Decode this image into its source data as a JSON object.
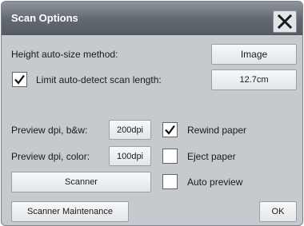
{
  "dialog": {
    "title": "Scan Options"
  },
  "height_method": {
    "label": "Height auto-size method:",
    "value": "Image"
  },
  "limit_scan": {
    "label": "Limit auto-detect scan length:",
    "checked": true,
    "value": "12.7cm"
  },
  "preview_bw": {
    "label": "Preview dpi, b&w:",
    "value": "200dpi"
  },
  "preview_color": {
    "label": "Preview dpi, color:",
    "value": "100dpi"
  },
  "scanner_button": "Scanner",
  "options": {
    "rewind": {
      "label": "Rewind paper",
      "checked": true
    },
    "eject": {
      "label": "Eject paper",
      "checked": false
    },
    "auto_preview": {
      "label": "Auto preview",
      "checked": false
    }
  },
  "footer": {
    "maintenance_label": "Scanner Maintenance",
    "ok_label": "OK"
  },
  "icons": {
    "close": "close-icon",
    "check": "checkmark-icon"
  }
}
